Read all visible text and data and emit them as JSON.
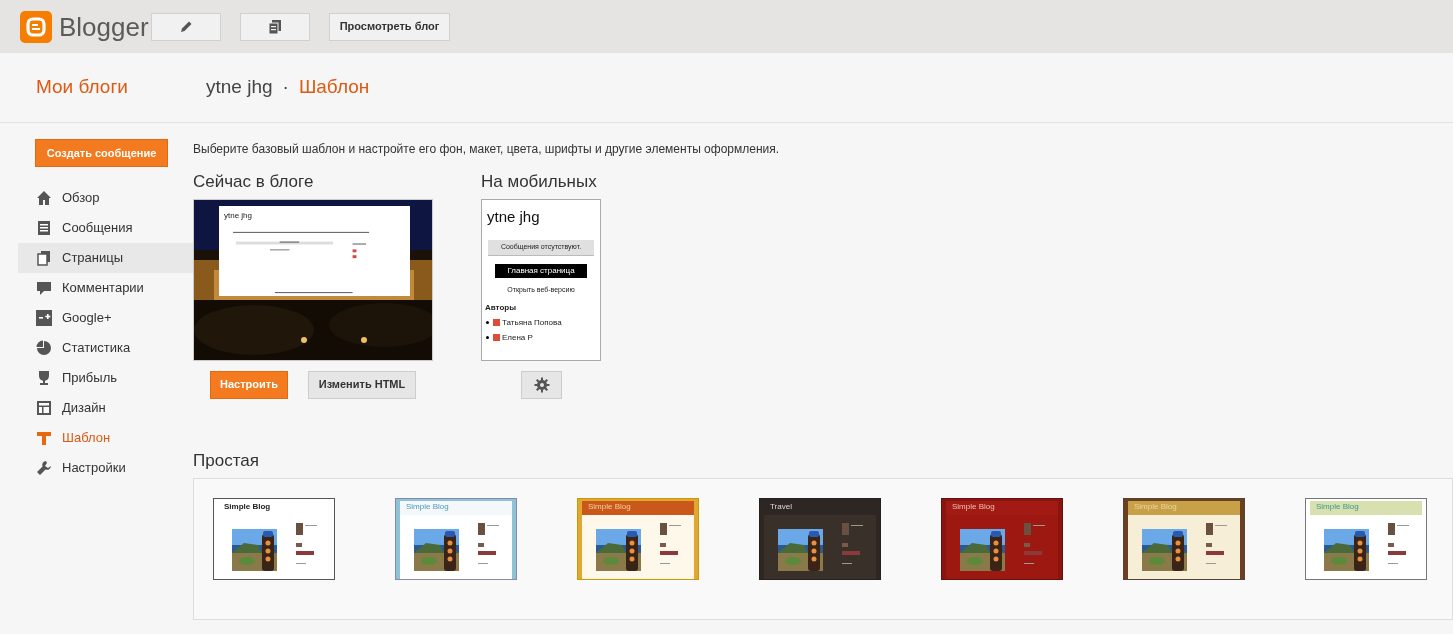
{
  "app": {
    "name": "Blogger"
  },
  "toolbar": {
    "view_blog_button": "Просмотреть блог"
  },
  "header": {
    "my_blogs": "Мои блоги",
    "blog_name": "ytne jhg",
    "separator": "·",
    "section": "Шаблон"
  },
  "sidebar": {
    "create_button": "Создать сообщение",
    "items": [
      {
        "label": "Обзор",
        "selected": false,
        "highlighted": false
      },
      {
        "label": "Сообщения",
        "selected": false,
        "highlighted": false
      },
      {
        "label": "Страницы",
        "selected": false,
        "highlighted": true
      },
      {
        "label": "Комментарии",
        "selected": false,
        "highlighted": false
      },
      {
        "label": "Google+",
        "selected": false,
        "highlighted": false
      },
      {
        "label": "Статистика",
        "selected": false,
        "highlighted": false
      },
      {
        "label": "Прибыль",
        "selected": false,
        "highlighted": false
      },
      {
        "label": "Дизайн",
        "selected": false,
        "highlighted": false
      },
      {
        "label": "Шаблон",
        "selected": true,
        "highlighted": false
      },
      {
        "label": "Настройки",
        "selected": false,
        "highlighted": false
      }
    ]
  },
  "intro": "Выберите базовый шаблон и настройте его фон, макет, цвета, шрифты и другие элементы оформления.",
  "current": {
    "heading": "Сейчас в блоге",
    "preview_title": "ytne jhg",
    "customize_button": "Настроить",
    "edit_html_button": "Изменить HTML"
  },
  "mobile": {
    "heading": "На мобильных",
    "title": "ytne jhg",
    "no_posts": "Сообщения отсутствуют.",
    "home_button": "Главная страница",
    "web_version": "Открыть веб-версию",
    "authors_heading": "Авторы",
    "authors": [
      "Татьяна Попова",
      "Елена Р"
    ]
  },
  "templates": {
    "heading": "Простая",
    "items": [
      {
        "kind": "plain",
        "title": "Simple Blog"
      },
      {
        "kind": "sky",
        "title": "Simple Blog"
      },
      {
        "kind": "orange",
        "title": "Simple Blog"
      },
      {
        "kind": "dark",
        "title": "Travel"
      },
      {
        "kind": "red",
        "title": "Simple Blog"
      },
      {
        "kind": "golden",
        "title": "Simple Blog"
      },
      {
        "kind": "green",
        "title": "Simple Blog"
      }
    ]
  }
}
